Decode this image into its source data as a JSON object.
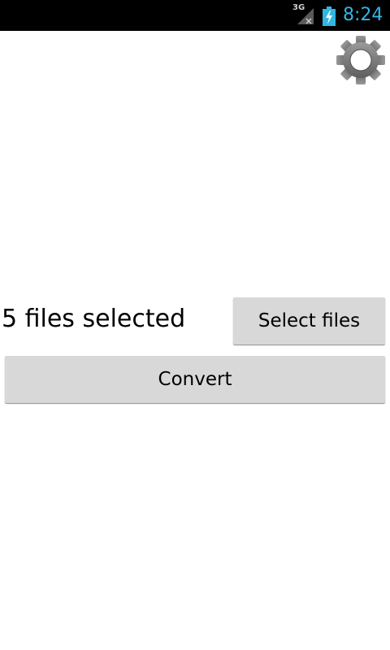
{
  "status_bar": {
    "network_label": "3G",
    "time": "8:24",
    "clock_color": "#33b5e5",
    "battery_color": "#33b5e5"
  },
  "toolbar": {
    "settings_icon": "gear-icon"
  },
  "main": {
    "file_count_text": "5 files selected",
    "select_files_label": "Select files",
    "convert_label": "Convert"
  }
}
